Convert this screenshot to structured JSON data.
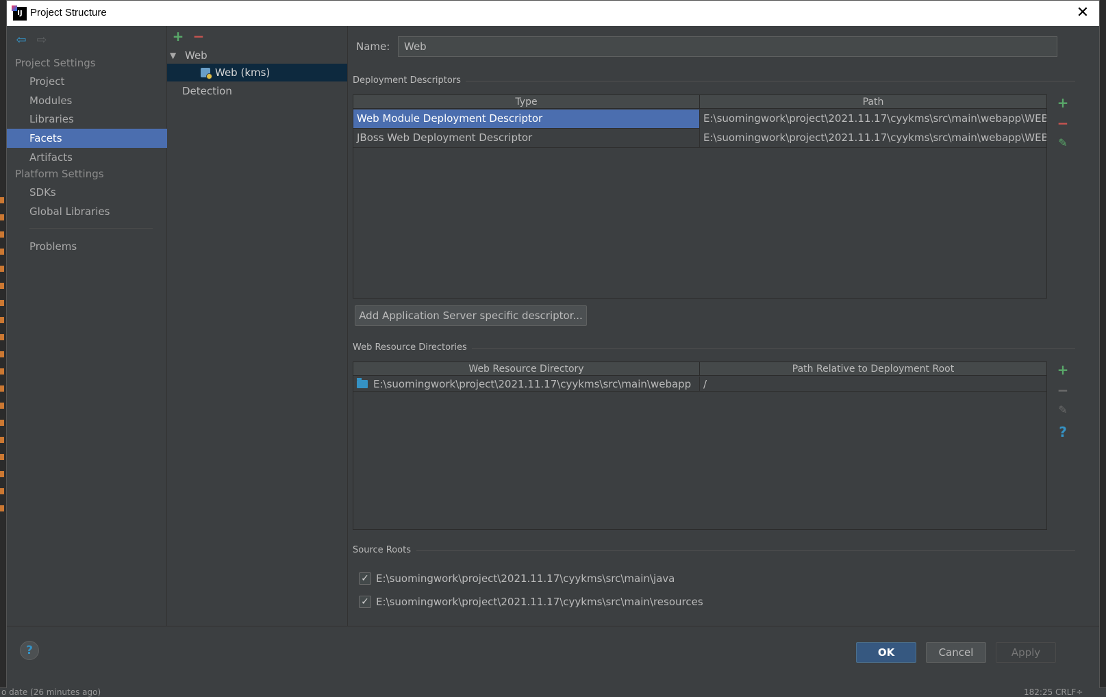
{
  "window": {
    "title": "Project Structure",
    "close_glyph": "✕"
  },
  "nav": {
    "back_glyph": "⇦",
    "forward_glyph": "⇨",
    "project_settings_heading": "Project Settings",
    "project_settings_items": [
      {
        "label": "Project",
        "selected": false
      },
      {
        "label": "Modules",
        "selected": false
      },
      {
        "label": "Libraries",
        "selected": false
      },
      {
        "label": "Facets",
        "selected": true
      },
      {
        "label": "Artifacts",
        "selected": false
      }
    ],
    "platform_settings_heading": "Platform Settings",
    "platform_settings_items": [
      {
        "label": "SDKs"
      },
      {
        "label": "Global Libraries"
      }
    ],
    "problems_label": "Problems"
  },
  "tree": {
    "add_glyph": "+",
    "remove_glyph": "−",
    "expand_glyph": "▼",
    "root_label": "Web",
    "child_label": "Web (kms)",
    "detection_label": "Detection"
  },
  "facet": {
    "name_label": "Name:",
    "name_value": "Web",
    "deployment_descriptors": {
      "title": "Deployment Descriptors",
      "columns": [
        "Type",
        "Path"
      ],
      "rows": [
        {
          "type": "Web Module Deployment Descriptor",
          "path": "E:\\suomingwork\\project\\2021.11.17\\cyykms\\src\\main\\webapp\\WEB-INF\\web.xml",
          "selected": true
        },
        {
          "type": "JBoss Web Deployment Descriptor",
          "path": "E:\\suomingwork\\project\\2021.11.17\\cyykms\\src\\main\\webapp\\WEB-INF\\jboss-web.xml",
          "selected": false
        }
      ],
      "add_server_button": "Add Application Server specific descriptor..."
    },
    "web_resource_directories": {
      "title": "Web Resource Directories",
      "columns": [
        "Web Resource Directory",
        "Path Relative to Deployment Root"
      ],
      "rows": [
        {
          "directory": "E:\\suomingwork\\project\\2021.11.17\\cyykms\\src\\main\\webapp",
          "relative_path": "/"
        }
      ]
    },
    "source_roots": {
      "title": "Source Roots",
      "items": [
        {
          "path": "E:\\suomingwork\\project\\2021.11.17\\cyykms\\src\\main\\java",
          "checked": true
        },
        {
          "path": "E:\\suomingwork\\project\\2021.11.17\\cyykms\\src\\main\\resources",
          "checked": true
        }
      ]
    },
    "side_tools": {
      "add": "+",
      "remove": "−",
      "edit": "✎",
      "help": "?"
    }
  },
  "footer": {
    "help_glyph": "?",
    "ok_label": "OK",
    "cancel_label": "Cancel",
    "apply_label": "Apply"
  },
  "ide_status": {
    "left_text": "o date (26 minutes ago)",
    "right_text": "182:25   CRLF÷"
  },
  "colors": {
    "accent_selection": "#4b6eaf",
    "tree_selection": "#0d293e",
    "add_green": "#59a869",
    "remove_red": "#c75450",
    "help_blue": "#3592c4"
  }
}
